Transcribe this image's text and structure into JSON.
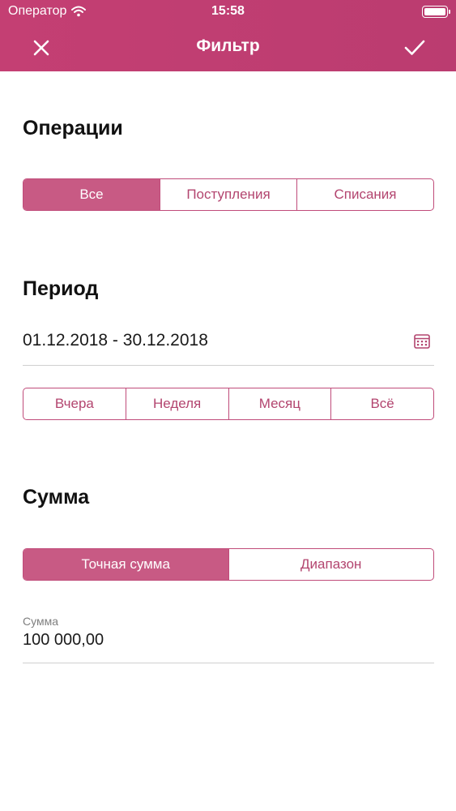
{
  "status_bar": {
    "carrier": "Оператор",
    "time": "15:58"
  },
  "nav": {
    "title": "Фильтр",
    "close_icon": "close-icon",
    "done_icon": "checkmark-icon"
  },
  "operations": {
    "title": "Операции",
    "options": [
      "Все",
      "Поступления",
      "Списания"
    ],
    "selected_index": 0
  },
  "period": {
    "title": "Период",
    "value": "01.12.2018 - 30.12.2018",
    "calendar_icon": "calendar-icon",
    "presets": [
      "Вчера",
      "Неделя",
      "Месяц",
      "Всё"
    ]
  },
  "amount": {
    "title": "Сумма",
    "modes": [
      "Точная сумма",
      "Диапазон"
    ],
    "selected_index": 0,
    "field_label": "Сумма",
    "field_value": "100 000,00"
  },
  "colors": {
    "accent": "#c43f73",
    "segment_active": "#c85a84",
    "segment_text": "#b3456f"
  }
}
